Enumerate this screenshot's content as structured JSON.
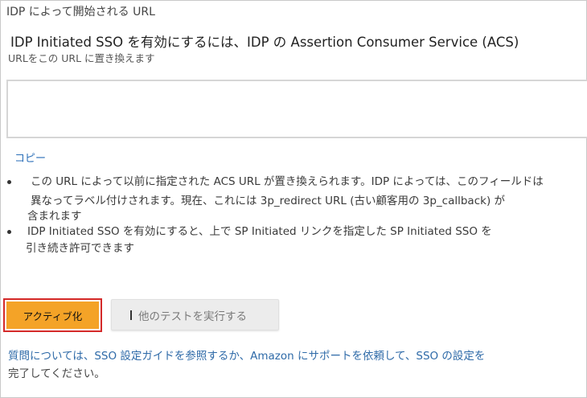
{
  "section_title": "IDP によって開始される URL",
  "heading": "IDP Initiated SSO を有効にするには、IDP の Assertion Consumer Service (ACS)",
  "subheading": "URLをこの URL に置き換えます",
  "url_field": {
    "value": "",
    "placeholder": ""
  },
  "copy_link": "コピー",
  "bullets": [
    {
      "lines": [
        "この URL によって以前に指定された ACS URL が置き換えられます。IDP によっては、このフィールドは",
        "異なってラベル付けされます。現在、これには 3p_redirect URL (古い顧客用の 3p_callback) が",
        "含まれます"
      ]
    },
    {
      "lines": [
        "IDP Initiated SSO を有効にすると、上で SP Initiated リンクを指定した SP Initiated SSO を",
        "引き続き許可できます"
      ]
    }
  ],
  "buttons": {
    "activate": "アクティブ化",
    "run_other_tests": "他のテストを実行する"
  },
  "help": {
    "line1": "質問については、SSO 設定ガイドを参照するか、Amazon にサポートを依頼して、SSO の設定を",
    "line2": "完了してください。"
  },
  "colors": {
    "activate_bg": "#f4a327",
    "activate_border": "#d42a2a",
    "link": "#2a6eb8",
    "secondary_button_bg": "#ececec"
  },
  "icons": {
    "test_button_icon": "text-cursor-icon"
  }
}
